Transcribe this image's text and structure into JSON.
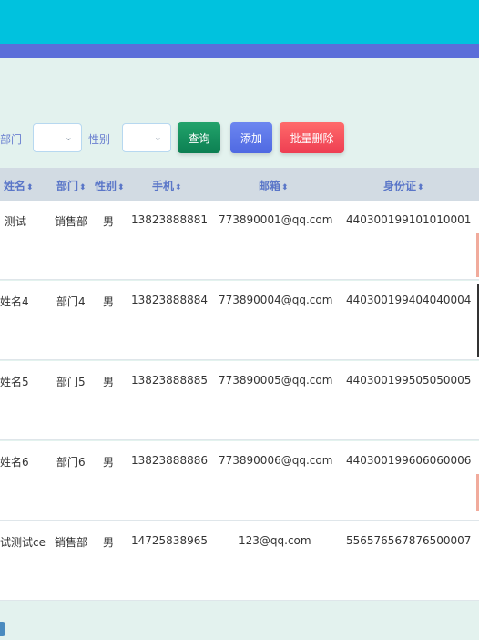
{
  "filters": {
    "dept_label": "部门",
    "sex_label": "性别"
  },
  "buttons": {
    "search": "查询",
    "add": "添加",
    "batch_delete": "批量删除"
  },
  "columns": [
    "姓名",
    "部门",
    "性别",
    "手机",
    "邮箱",
    "身份证"
  ],
  "rows": [
    {
      "name": "测试",
      "dept": "销售部",
      "sex": "男",
      "phone": "13823888881",
      "email": "773890001@qq.com",
      "id": "440300199101010001"
    },
    {
      "name": "姓名4",
      "dept": "部门4",
      "sex": "男",
      "phone": "13823888884",
      "email": "773890004@qq.com",
      "id": "440300199404040004"
    },
    {
      "name": "姓名5",
      "dept": "部门5",
      "sex": "男",
      "phone": "13823888885",
      "email": "773890005@qq.com",
      "id": "440300199505050005"
    },
    {
      "name": "姓名6",
      "dept": "部门6",
      "sex": "男",
      "phone": "13823888886",
      "email": "773890006@qq.com",
      "id": "440300199606060006"
    },
    {
      "name": "试测试ce",
      "dept": "销售部",
      "sex": "男",
      "phone": "14725838965",
      "email": "123@qq.com",
      "id": "556576567876500007"
    }
  ]
}
